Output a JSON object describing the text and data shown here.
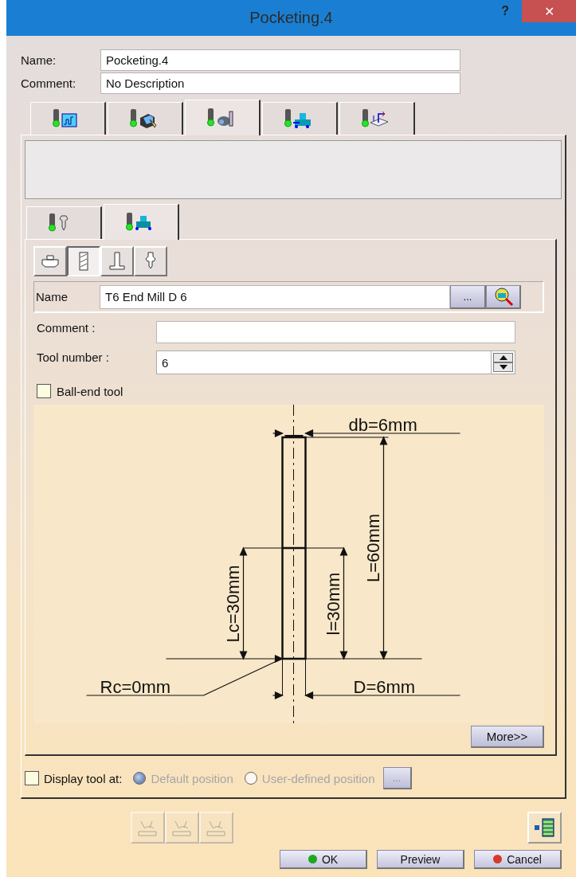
{
  "window": {
    "title": "Pocketing.4",
    "help": "?",
    "close": "✕"
  },
  "name": {
    "label": "Name:",
    "value": "Pocketing.4"
  },
  "comment": {
    "label": "Comment:",
    "value": "No Description"
  },
  "tabs": [
    {
      "selected": false
    },
    {
      "selected": false
    },
    {
      "selected": true
    },
    {
      "selected": false
    },
    {
      "selected": false
    }
  ],
  "subtabs": [
    {
      "selected": false
    },
    {
      "selected": true
    }
  ],
  "tool_types": [
    {
      "selected": false
    },
    {
      "selected": true
    },
    {
      "selected": false
    },
    {
      "selected": false
    }
  ],
  "tool": {
    "name_label": "Name",
    "name_value": "T6 End Mill D 6",
    "browse": "...",
    "comment_label": "Comment :",
    "number_label": "Tool number :",
    "number_value": "6",
    "ball_end": {
      "label": "Ball-end tool",
      "checked": false
    }
  },
  "diagram": {
    "labels": [
      "db=6mm",
      "L=60mm",
      "Lc=30mm",
      "l=30mm",
      "Rc=0mm",
      "D=6mm"
    ]
  },
  "more": "More>>",
  "display": {
    "label": "Display tool at:",
    "checked": false,
    "options": [
      {
        "label": "Default position",
        "selected": true,
        "disabled": true
      },
      {
        "label": "User-defined position",
        "selected": false,
        "disabled": true
      }
    ],
    "browse": "..."
  },
  "toolbar": [
    {
      "disabled": true
    },
    {
      "disabled": true
    },
    {
      "disabled": true
    }
  ],
  "buttons": [
    "OK",
    "Preview",
    "Cancel"
  ]
}
